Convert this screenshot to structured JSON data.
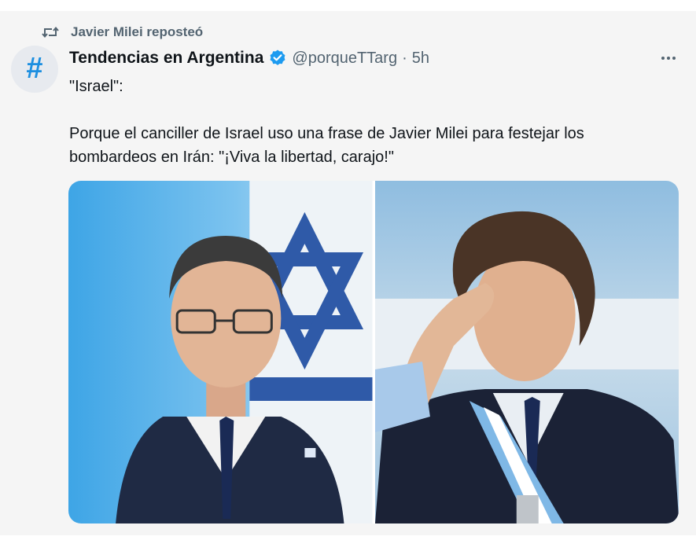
{
  "repost": {
    "label": "Javier Milei reposteó",
    "icon": "repost-icon"
  },
  "tweet": {
    "avatar_glyph": "#",
    "display_name": "Tendencias en Argentina",
    "handle": "@porqueTTarg",
    "separator": "·",
    "time": "5h",
    "body_line1": "\"Israel\":",
    "body_line2": "Porque el canciller de Israel uso una frase de Javier Milei para festejar los bombardeos en Irán: \"¡Viva la libertad, carajo!\""
  },
  "colors": {
    "accent": "#1d9bf0",
    "muted": "#536471",
    "text": "#0f1419"
  },
  "media": [
    {
      "name": "photo-israel-foreign-minister"
    },
    {
      "name": "photo-javier-milei"
    }
  ]
}
